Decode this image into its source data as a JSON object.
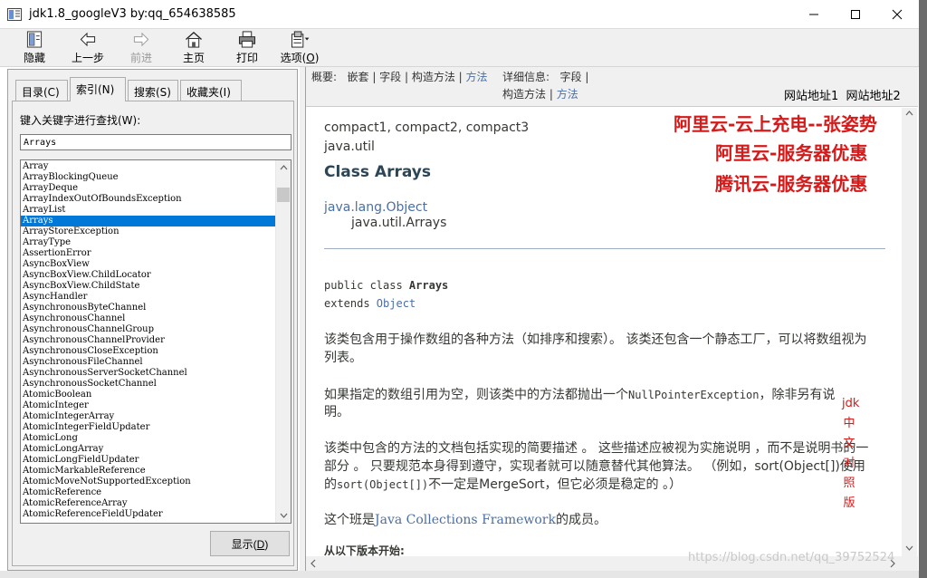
{
  "window": {
    "title": "jdk1.8_googleV3 by:qq_654638585"
  },
  "toolbar": {
    "hide": "隐藏",
    "back": "上一步",
    "forward": "前进",
    "home": "主页",
    "print": "打印",
    "options_label": "选项(",
    "options_key": "O",
    "options_end": ")"
  },
  "left": {
    "tabs": [
      "目录(C)",
      "索引(N)",
      "搜索(S)",
      "收藏夹(I)"
    ],
    "keyword_label": "键入关键字进行查找(W):",
    "keyword_value": "Arrays",
    "show_button": "显示(D)",
    "list": [
      "Array",
      "ArrayBlockingQueue",
      "ArrayDeque",
      "ArrayIndexOutOfBoundsException",
      "ArrayList",
      "Arrays",
      "ArrayStoreException",
      "ArrayType",
      "AssertionError",
      "AsyncBoxView",
      "AsyncBoxView.ChildLocator",
      "AsyncBoxView.ChildState",
      "AsyncHandler",
      "AsynchronousByteChannel",
      "AsynchronousChannel",
      "AsynchronousChannelGroup",
      "AsynchronousChannelProvider",
      "AsynchronousCloseException",
      "AsynchronousFileChannel",
      "AsynchronousServerSocketChannel",
      "AsynchronousSocketChannel",
      "AtomicBoolean",
      "AtomicInteger",
      "AtomicIntegerArray",
      "AtomicIntegerFieldUpdater",
      "AtomicLong",
      "AtomicLongArray",
      "AtomicLongFieldUpdater",
      "AtomicMarkableReference",
      "AtomicMoveNotSupportedException",
      "AtomicReference",
      "AtomicReferenceArray",
      "AtomicReferenceFieldUpdater"
    ],
    "selected": "Arrays"
  },
  "nav": {
    "summary_label": "概要:",
    "summary_items": "嵌套 | 字段 | 构造方法 | ",
    "summary_link": "方法",
    "detail_label": "详细信息:",
    "detail_line1": "字段 |",
    "detail_line2": "构造方法 | ",
    "detail_link": "方法",
    "site1": "网站地址1",
    "site2": "网站地址2"
  },
  "doc": {
    "profiles": "compact1, compact2, compact3",
    "package": "java.util",
    "class_title": "Class Arrays",
    "inherit_parent": "java.lang.Object",
    "inherit_child": "java.util.Arrays",
    "decl_1a": "public class ",
    "decl_1b": "Arrays",
    "decl_2a": "extends ",
    "decl_2b": "Object",
    "p1_line1": "该类包含用于操作数组的各种方法（如排序和搜索）。 该类还包含一个静态工厂，可以将数组视为",
    "p1_line2": "列表。",
    "p2_a": "如果指定的数组引用为空，则该类中的方法都抛出一个",
    "p2_code": "NullPointerException",
    "p2_b": "，除非另有说",
    "p2_line2": "明。",
    "p3_line1": "该类中包含的方法的文档包括实现的简要描述 。 这些描述应被视为实施说明 ，而不是说明书的一",
    "p3_line2": "部分 。 只要规范本身得到遵守，实现者就可以随意替代其他算法。 （例如，sort(Object[])使用",
    "p3_line3a": "的",
    "p3_code": "sort(Object[])",
    "p3_line3b": "不一定是MergeSort，但它必须是稳定的 。）",
    "p4_a": "这个班是",
    "p4_link": "Java Collections Framework",
    "p4_b": "的成员。",
    "since_label": "从以下版本开始:"
  },
  "ads": {
    "line1": "阿里云-云上充电--张姿势",
    "line2": "阿里云-服务器优惠",
    "line3": "腾讯云-服务器优惠",
    "vertical": [
      "jdk",
      "中",
      "文",
      "对",
      "照",
      "版"
    ]
  },
  "watermark": "https://blog.csdn.net/qq_39752524",
  "colors": {
    "accent": "#0078d7",
    "ad_red": "#d61919",
    "link": "#4a6fa5"
  }
}
